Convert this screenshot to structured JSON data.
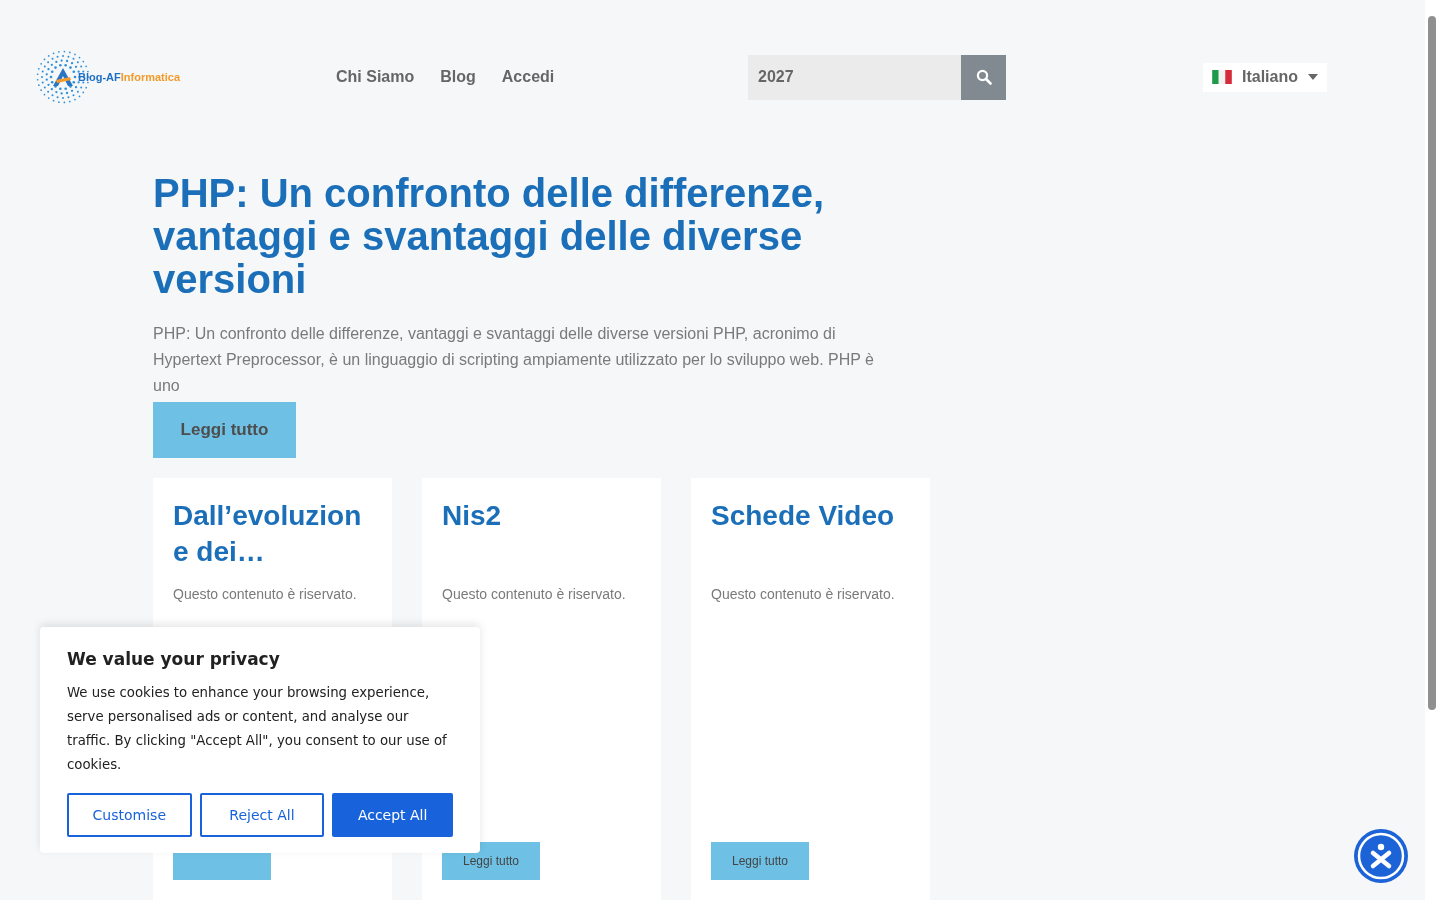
{
  "header": {
    "logo": {
      "part_1": "Blog-AF",
      "part_2": "Informatica"
    },
    "nav": [
      {
        "label": "Chi Siamo"
      },
      {
        "label": "Blog"
      },
      {
        "label": "Accedi"
      }
    ],
    "search": {
      "value": "2027"
    },
    "language": {
      "label": "Italiano"
    }
  },
  "featured": {
    "title": "PHP: Un confronto delle differenze, vantaggi e svantaggi delle diverse versioni",
    "excerpt": "PHP: Un confronto delle differenze, vantaggi e svantaggi delle diverse versioni PHP, acronimo di Hypertext Preprocessor, è un linguaggio di scripting ampiamente utilizzato per lo sviluppo web. PHP è uno",
    "button": "Leggi tutto"
  },
  "cards": [
    {
      "title": "Dall’evoluzion e dei…",
      "text": "Questo contenuto è riservato."
    },
    {
      "title": "Nis2",
      "text": "Questo contenuto è riservato.",
      "button": "Leggi tutto"
    },
    {
      "title": "Schede Video",
      "text": "Questo contenuto è riservato.",
      "button": "Leggi tutto"
    }
  ],
  "cookie_banner": {
    "title": "We value your privacy",
    "text": "We use cookies to enhance your browsing experience, serve personalised ads or content, and analyse our traffic. By clicking \"Accept All\", you consent to our use of cookies.",
    "buttons": [
      {
        "label": "Customise",
        "kind": "outline"
      },
      {
        "label": "Reject All",
        "kind": "outline"
      },
      {
        "label": "Accept All",
        "kind": "primary"
      }
    ]
  }
}
